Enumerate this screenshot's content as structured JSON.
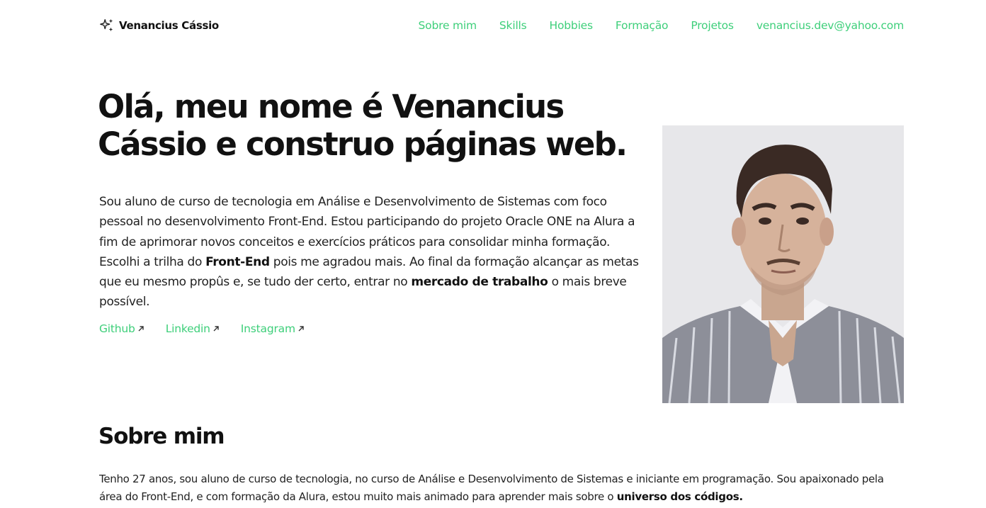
{
  "header": {
    "brand_icon": "sparkles-icon",
    "brand_name": "Venancius Cássio",
    "nav": [
      {
        "label": "Sobre mim"
      },
      {
        "label": "Skills"
      },
      {
        "label": "Hobbies"
      },
      {
        "label": "Formação"
      },
      {
        "label": "Projetos"
      },
      {
        "label": "venancius.dev@yahoo.com"
      }
    ]
  },
  "hero": {
    "title": "Olá, meu nome é Venancius Cássio e construo páginas web.",
    "paragraph": {
      "part1": "Sou aluno de curso de tecnologia em Análise e Desenvolvimento de Sistemas com foco pessoal no desenvolvimento Front-End. Estou participando do projeto Oracle ONE na Alura a fim de aprimorar novos conceitos e exercícios práticos para consolidar minha formação. Escolhi a trilha do ",
      "bold1": "Front-End",
      "part2": " pois me agradou mais. Ao final da formação alcançar as metas que eu mesmo propûs e, se tudo der certo, entrar no ",
      "bold2": "mercado de trabalho",
      "part3": " o mais breve possível."
    },
    "links": [
      {
        "label": "Github",
        "icon": "external-arrow-icon"
      },
      {
        "label": "Linkedin",
        "icon": "external-arrow-icon"
      },
      {
        "label": "Instagram",
        "icon": "external-arrow-icon"
      }
    ]
  },
  "about": {
    "title": "Sobre mim",
    "part1": "Tenho 27 anos, sou aluno de curso de tecnologia, no curso de Análise e Desenvolvimento de Sistemas e iniciante em programação. Sou apaixonado pela área do Front-End, e com formação da Alura, estou muito mais animado para aprender mais sobre o ",
    "bold1": "universo dos códigos."
  },
  "colors": {
    "accent": "#3ecf7a",
    "text": "#111111",
    "background": "#ffffff"
  }
}
